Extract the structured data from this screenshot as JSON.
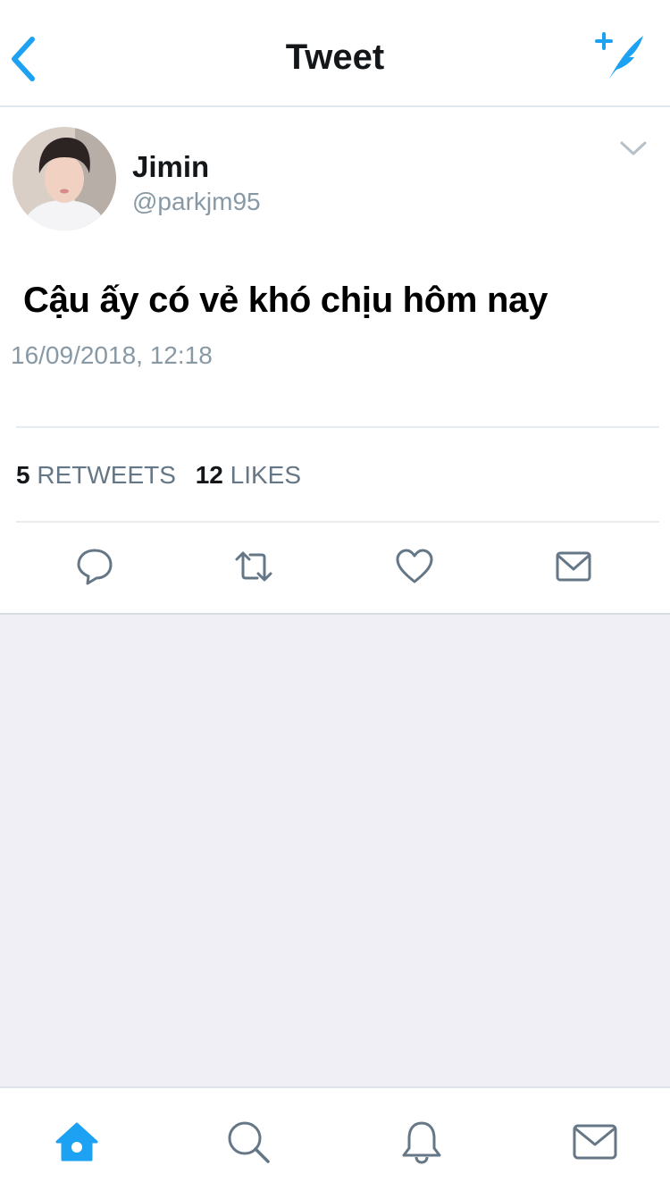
{
  "header": {
    "title": "Tweet",
    "back_icon": "chevron-left-icon",
    "compose_icon": "compose-tweet-icon"
  },
  "tweet": {
    "author_name": "Jimin",
    "author_handle": "@parkjm95",
    "text": "Cậu ấy có vẻ khó chịu hôm nay",
    "timestamp": "16/09/2018, 12:18",
    "retweets_count": "5",
    "retweets_label": "RETWEETS",
    "likes_count": "12",
    "likes_label": "LIKES",
    "actions": [
      "reply-icon",
      "retweet-icon",
      "like-icon",
      "message-icon"
    ]
  },
  "tabbar": {
    "items": [
      "home-icon",
      "search-icon",
      "notifications-icon",
      "messages-icon"
    ],
    "active": "home"
  },
  "colors": {
    "accent": "#1da1f2",
    "icon_gray": "#657786",
    "secondary_text": "#8899a6",
    "empty_bg": "#efeff5"
  }
}
